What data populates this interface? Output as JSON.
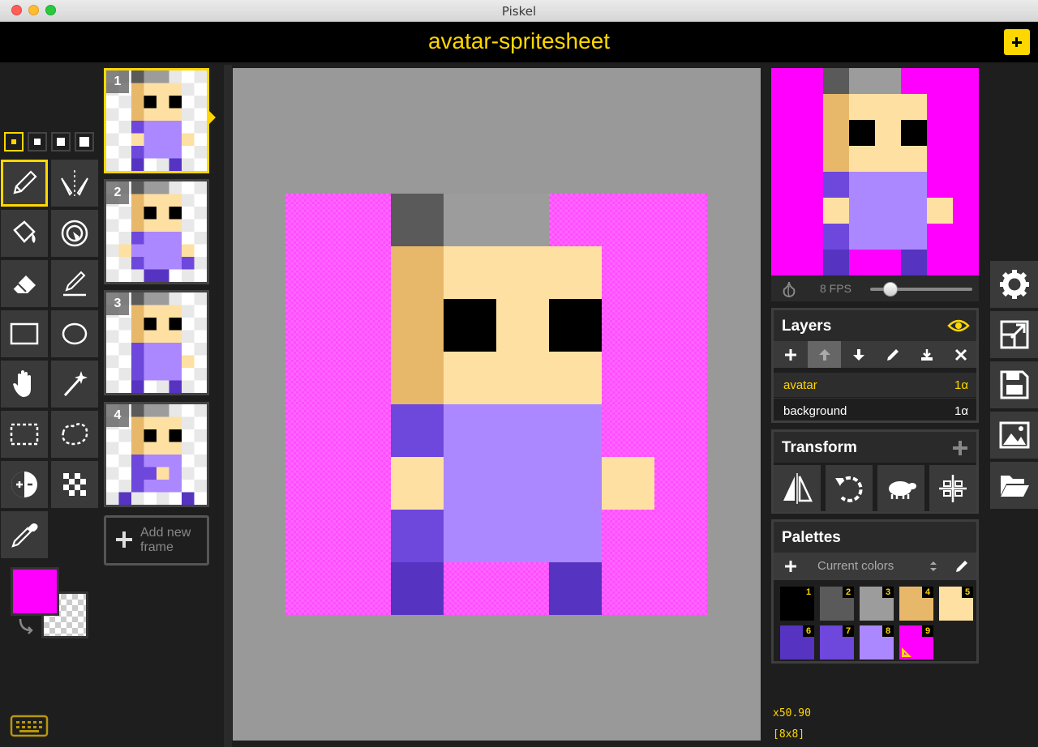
{
  "window": {
    "title": "Piskel"
  },
  "header": {
    "piskel_name": "avatar-spritesheet",
    "new_icon": "plus-icon"
  },
  "pen_sizes": [
    1,
    2,
    3,
    4
  ],
  "tools": [
    {
      "name": "pen-tool",
      "icon": "pencil-icon"
    },
    {
      "name": "vertical-mirror-pen-tool",
      "icon": "mirror-pen-icon"
    },
    {
      "name": "paint-bucket-tool",
      "icon": "bucket-icon"
    },
    {
      "name": "paint-all-same-color-tool",
      "icon": "spiral-bucket-icon"
    },
    {
      "name": "eraser-tool",
      "icon": "eraser-icon"
    },
    {
      "name": "stroke-tool",
      "icon": "stroke-icon"
    },
    {
      "name": "rectangle-tool",
      "icon": "rectangle-icon"
    },
    {
      "name": "circle-tool",
      "icon": "circle-icon"
    },
    {
      "name": "move-tool",
      "icon": "hand-icon"
    },
    {
      "name": "shape-selection-tool",
      "icon": "magic-wand-icon"
    },
    {
      "name": "rectangle-selection-tool",
      "icon": "rect-select-icon"
    },
    {
      "name": "lasso-selection-tool",
      "icon": "lasso-icon"
    },
    {
      "name": "lighten-tool",
      "icon": "lighten-icon"
    },
    {
      "name": "dithering-tool",
      "icon": "dither-icon"
    },
    {
      "name": "color-picker-tool",
      "icon": "eyedropper-icon"
    }
  ],
  "colors": {
    "primary": "#ff00ff",
    "secondary": "transparent"
  },
  "frames": [
    {
      "number": "1"
    },
    {
      "number": "2"
    },
    {
      "number": "3"
    },
    {
      "number": "4"
    }
  ],
  "add_frame": {
    "line1": "Add new",
    "line2": "frame"
  },
  "preview": {
    "fps_label": "8 FPS",
    "fps": 8,
    "fps_fraction": 0.2
  },
  "layers": {
    "title": "Layers",
    "items": [
      {
        "name": "avatar",
        "opacity": "1α",
        "selected": true
      },
      {
        "name": "background",
        "opacity": "1α",
        "selected": false
      }
    ]
  },
  "transform": {
    "title": "Transform"
  },
  "palettes": {
    "title": "Palettes",
    "selected": "Current colors",
    "swatches": [
      {
        "n": "1",
        "color": "#000000"
      },
      {
        "n": "2",
        "color": "#5a5a5a"
      },
      {
        "n": "3",
        "color": "#9c9c9c"
      },
      {
        "n": "4",
        "color": "#e8b86a"
      },
      {
        "n": "5",
        "color": "#ffe0a3"
      },
      {
        "n": "6",
        "color": "#5633c0"
      },
      {
        "n": "7",
        "color": "#6e47dc"
      },
      {
        "n": "8",
        "color": "#ab88ff"
      },
      {
        "n": "9",
        "color": "#ff00ff"
      }
    ]
  },
  "status": {
    "zoom": "x50.90",
    "size": "[8x8]"
  },
  "sprite": {
    "palette": {
      "M": "#ff00ff",
      "D": "#5a5a5a",
      "G": "#9c9c9c",
      "T": "#e8b86a",
      "S": "#ffe0a3",
      "K": "#000000",
      "P": "#5633c0",
      "Q": "#6e47dc",
      "L": "#ab88ff"
    },
    "frames": [
      [
        "MMDGGMMM",
        "MMTSSSMM",
        "MMTKSKMM",
        "MMTSSSMM",
        "MMQLLLMM",
        "MMSLLLSM",
        "MMQLLLMM",
        "MMPMMPMM"
      ],
      [
        "MMDGGMMM",
        "MMTSSSMM",
        "MMTKSKMM",
        "MMTSSSMM",
        "MMQLLLMM",
        "MSLLLLSM",
        "MMQLLLQM",
        "MMMPPMMM"
      ],
      [
        "MMDGGMMM",
        "MMTSSSMM",
        "MMTKSKMM",
        "MMTSSSMM",
        "MMQLLLMM",
        "MMQLLLSM",
        "MMQLLLMM",
        "MMPMMPMM"
      ],
      [
        "MMDGGMMM",
        "MMTSSSMM",
        "MMTKSKMM",
        "MMTSSSMM",
        "MMQLLLMM",
        "MMQQSLMM",
        "MMQLLLMM",
        "MPMMMMPM"
      ]
    ]
  }
}
